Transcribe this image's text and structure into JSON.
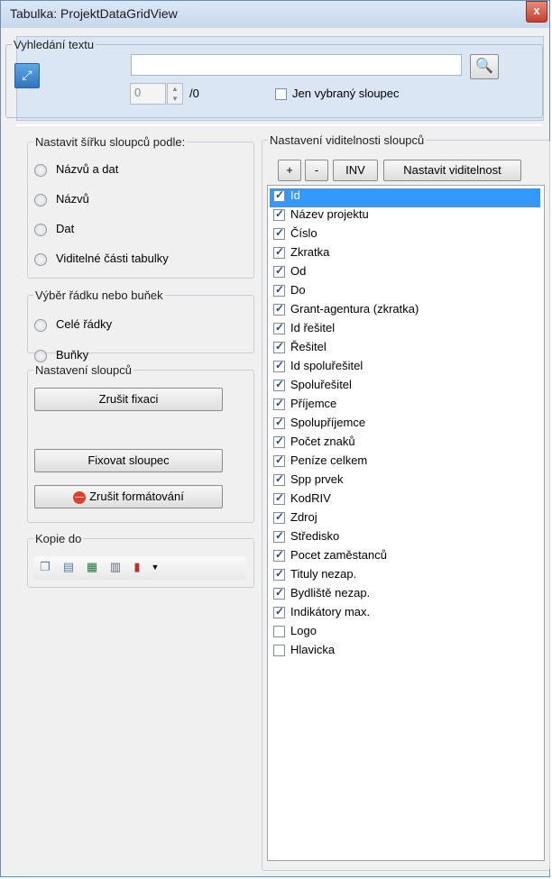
{
  "window": {
    "title": "Tabulka: ProjektDataGridView",
    "close_symbol": "x"
  },
  "search": {
    "legend": "Vyhledání textu",
    "input_value": "",
    "spin_value": "0",
    "count": "/0",
    "selected_column_label": "Jen vybraný sloupec",
    "selected_column_checked": false
  },
  "width_group": {
    "legend": "Nastavit šířku sloupců podle:",
    "options": [
      "Názvů a dat",
      "Názvů",
      "Dat",
      "Viditelné části tabulky"
    ]
  },
  "row_group": {
    "legend": "Výběr řádku nebo buňek",
    "options": [
      "Celé řádky",
      "Buňky"
    ]
  },
  "columns_group": {
    "legend": "Nastavení sloupců",
    "buttons": [
      "Zrušit fixaci",
      "Fixovat sloupec",
      "Zrušit formátování"
    ]
  },
  "copy_group": {
    "legend": "Kopie do"
  },
  "visibility": {
    "legend": "Nastavení  viditelnosti sloupců",
    "buttons": {
      "plus": "+",
      "minus": "-",
      "inv": "INV",
      "set": "Nastavit viditelnost"
    },
    "items": [
      {
        "label": "Id",
        "checked": true,
        "selected": true
      },
      {
        "label": "Název projektu",
        "checked": true
      },
      {
        "label": "Číslo",
        "checked": true
      },
      {
        "label": "Zkratka",
        "checked": true
      },
      {
        "label": "Od",
        "checked": true
      },
      {
        "label": "Do",
        "checked": true
      },
      {
        "label": "Grant-agentura (zkratka)",
        "checked": true
      },
      {
        "label": "Id řešitel",
        "checked": true
      },
      {
        "label": "Řešitel",
        "checked": true
      },
      {
        "label": "Id spoluřešitel",
        "checked": true
      },
      {
        "label": "Spoluřešitel",
        "checked": true
      },
      {
        "label": "Příjemce",
        "checked": true
      },
      {
        "label": "Spolupříjemce",
        "checked": true
      },
      {
        "label": "Počet znaků",
        "checked": true
      },
      {
        "label": "Peníze celkem",
        "checked": true
      },
      {
        "label": "Spp prvek",
        "checked": true
      },
      {
        "label": "KodRIV",
        "checked": true
      },
      {
        "label": "Zdroj",
        "checked": true
      },
      {
        "label": "Středisko",
        "checked": true
      },
      {
        "label": "Pocet zaměstanců",
        "checked": true
      },
      {
        "label": "Tituly nezap.",
        "checked": true
      },
      {
        "label": "Bydliště nezap.",
        "checked": true
      },
      {
        "label": "Indikátory max.",
        "checked": true
      },
      {
        "label": "Logo",
        "checked": false
      },
      {
        "label": "Hlavicka",
        "checked": false
      }
    ]
  }
}
